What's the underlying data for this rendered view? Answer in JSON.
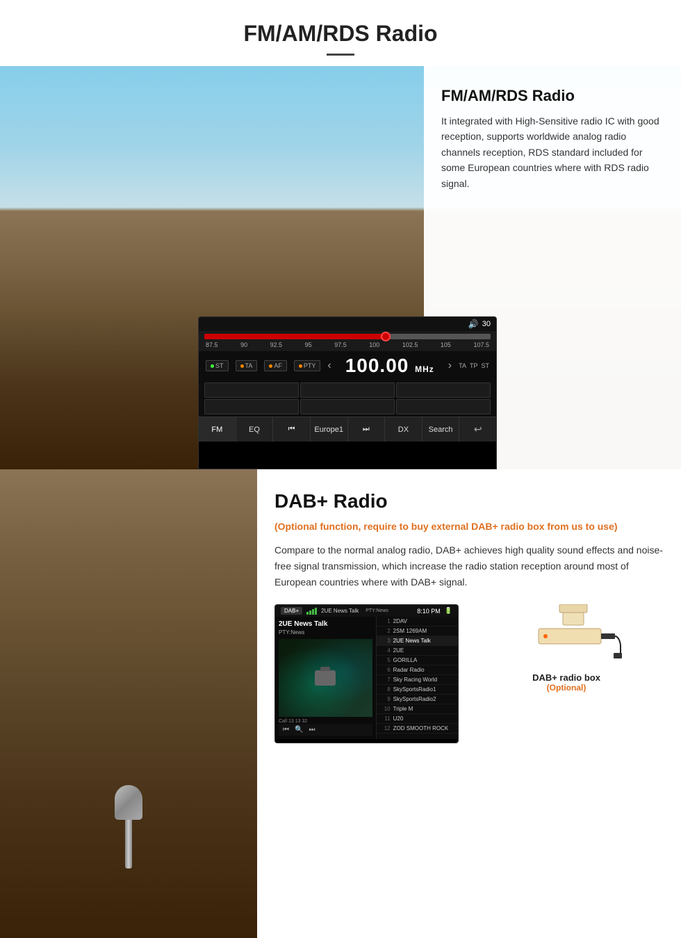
{
  "page": {
    "title": "FM/AM/RDS Radio",
    "title_divider": true
  },
  "fm_section": {
    "title": "FM/AM/RDS Radio",
    "description": "It integrated with High-Sensitive radio IC with good reception, supports worldwide analog radio channels reception, RDS standard included for some European countries where with RDS radio signal."
  },
  "radio_ui": {
    "volume": "30",
    "frequency": "100.00",
    "frequency_unit": "MHz",
    "freq_labels": [
      "87.5",
      "90",
      "92.5",
      "95",
      "97.5",
      "100",
      "102.5",
      "105",
      "107.5"
    ],
    "buttons": {
      "st": "ST",
      "ta": "TA",
      "af": "AF",
      "pty": "PTY",
      "ta2": "TA",
      "tp": "TP",
      "st2": "ST"
    },
    "bottom_buttons": [
      "FM",
      "EQ",
      "⏮",
      "Europe1",
      "⏭",
      "DX",
      "Search",
      "↩"
    ]
  },
  "dab_section": {
    "title": "DAB+ Radio",
    "optional_text": "(Optional function, require to buy external DAB+ radio box from us to use)",
    "description": "Compare to the normal analog radio, DAB+ achieves high quality sound effects and noise-free signal transmission, which increase the radio station reception around most of European countries where with DAB+ signal.",
    "dab_box_label": "DAB+ radio box",
    "dab_box_optional": "(Optional)"
  },
  "dab_ui": {
    "label": "DAB+",
    "station": "2UE News Talk",
    "pty": "PTY:News",
    "time": "8:10 PM",
    "call_info": "Call 13 13 32",
    "station_list": [
      {
        "num": "1",
        "name": "2DAV"
      },
      {
        "num": "2",
        "name": "2SM 1269AM"
      },
      {
        "num": "3",
        "name": "2UE News Talk",
        "active": true
      },
      {
        "num": "4",
        "name": "2UE"
      },
      {
        "num": "5",
        "name": "GORILLA"
      },
      {
        "num": "6",
        "name": "Radar Radio"
      },
      {
        "num": "7",
        "name": "Sky Racing World"
      },
      {
        "num": "8",
        "name": "SkySportsRadio1"
      },
      {
        "num": "9",
        "name": "SkySportsRadio2"
      },
      {
        "num": "10",
        "name": "Triple M"
      },
      {
        "num": "11",
        "name": "U20"
      },
      {
        "num": "12",
        "name": "ZOD SMOOTH ROCK"
      }
    ]
  }
}
